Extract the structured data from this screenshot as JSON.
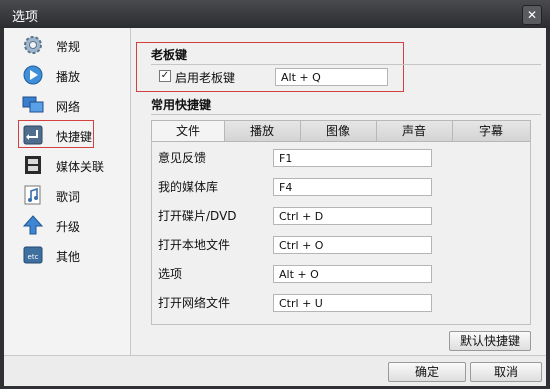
{
  "window": {
    "title": "选项"
  },
  "sidebar": {
    "items": [
      {
        "label": "常规",
        "icon": "gear-icon"
      },
      {
        "label": "播放",
        "icon": "play-icon"
      },
      {
        "label": "网络",
        "icon": "network-icon"
      },
      {
        "label": "快捷键",
        "icon": "enter-key-icon",
        "active": true
      },
      {
        "label": "媒体关联",
        "icon": "film-icon"
      },
      {
        "label": "歌词",
        "icon": "lyrics-icon"
      },
      {
        "label": "升级",
        "icon": "upgrade-arrow-icon"
      },
      {
        "label": "其他",
        "icon": "etc-icon"
      }
    ]
  },
  "boss_key": {
    "section_title": "老板键",
    "checkbox_label": "启用老板键",
    "checked": true,
    "value": "Alt + Q"
  },
  "shortcuts": {
    "section_title": "常用快捷键",
    "tabs": [
      "文件",
      "播放",
      "图像",
      "声音",
      "字幕"
    ],
    "active_tab": "文件",
    "rows": [
      {
        "label": "意见反馈",
        "value": "F1"
      },
      {
        "label": "我的媒体库",
        "value": "F4"
      },
      {
        "label": "打开碟片/DVD",
        "value": "Ctrl + D"
      },
      {
        "label": "打开本地文件",
        "value": "Ctrl + O"
      },
      {
        "label": "选项",
        "value": "Alt + O"
      },
      {
        "label": "打开网络文件",
        "value": "Ctrl + U"
      }
    ],
    "default_button": "默认快捷键"
  },
  "footer": {
    "ok": "确定",
    "cancel": "取消"
  }
}
